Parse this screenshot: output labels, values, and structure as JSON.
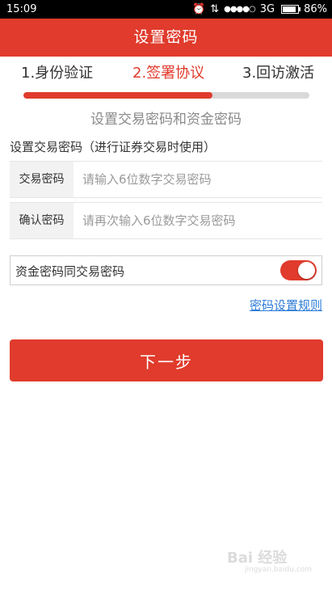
{
  "status_bar": {
    "time": "15:09",
    "network": "3G",
    "battery": "86%",
    "battery_level": 0.86,
    "signal_dots": "●●●●○"
  },
  "header": {
    "title": "设置密码"
  },
  "steps": [
    {
      "label": "1.身份验证"
    },
    {
      "label": "2.签署协议"
    },
    {
      "label": "3.回访激活"
    }
  ],
  "progress_fraction": 0.66,
  "subtitle": "设置交易密码和资金密码",
  "section_label": "设置交易密码（进行证券交易时使用）",
  "fields": {
    "trade_password": {
      "label": "交易密码",
      "placeholder": "请输入6位数字交易密码",
      "value": ""
    },
    "confirm_password": {
      "label": "确认密码",
      "placeholder": "请再次输入6位数字交易密码",
      "value": ""
    }
  },
  "same_as_trade": {
    "label": "资金密码同交易密码",
    "on": true
  },
  "rules_link": "密码设置规则",
  "next_button": "下一步",
  "watermark": {
    "line1": "Bai 经验",
    "line2": "jingyan.baidu.com"
  },
  "colors": {
    "accent": "#e03b2c",
    "link": "#2b7bd6"
  }
}
